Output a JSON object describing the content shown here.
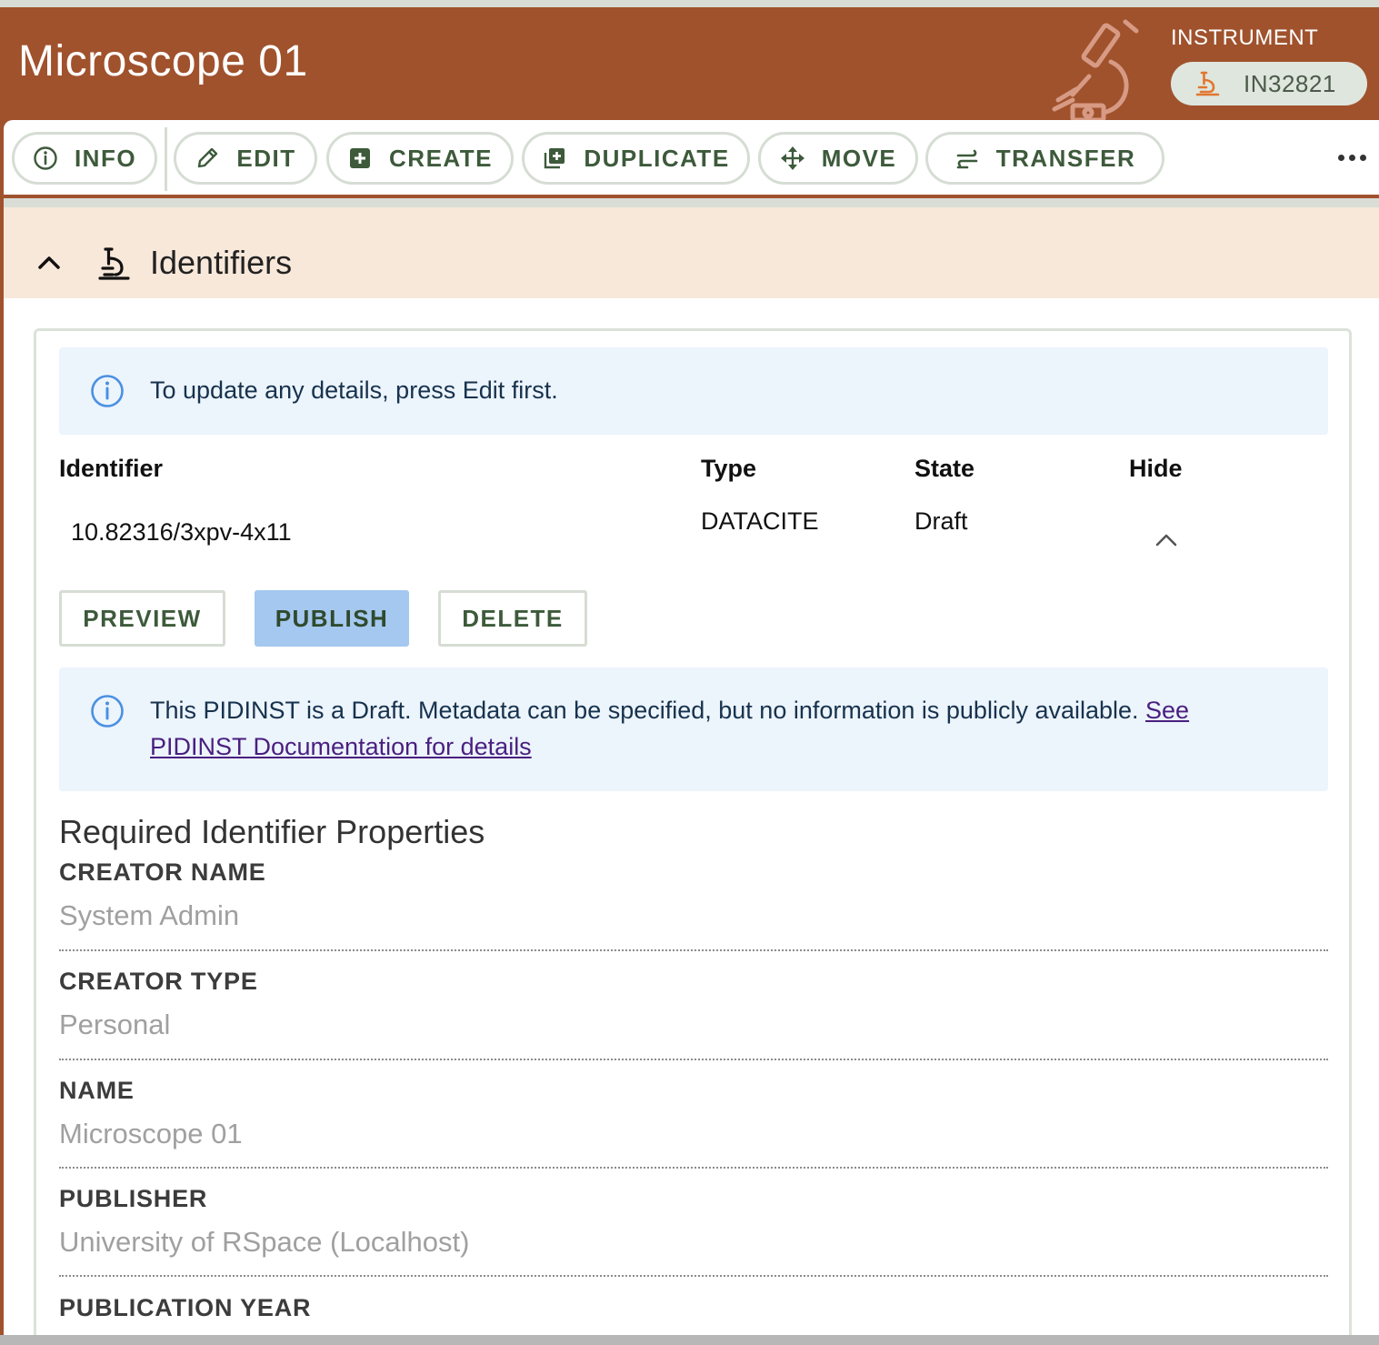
{
  "header": {
    "title": "Microscope 01",
    "type_label": "INSTRUMENT",
    "global_id": "IN32821",
    "background_icon": "microscope-icon"
  },
  "toolbar": {
    "buttons": [
      {
        "label": "INFO",
        "icon": "info-icon"
      },
      {
        "label": "EDIT",
        "icon": "pencil-icon"
      },
      {
        "label": "CREATE",
        "icon": "plus-box-icon"
      },
      {
        "label": "DUPLICATE",
        "icon": "duplicate-icon"
      },
      {
        "label": "MOVE",
        "icon": "move-arrows-icon"
      },
      {
        "label": "TRANSFER",
        "icon": "transfer-icon"
      }
    ],
    "more_icon": "more-horizontal-icon"
  },
  "section": {
    "title": "Identifiers",
    "expanded": true
  },
  "info_alert": {
    "text": "To update any details, press Edit first."
  },
  "identifier_table": {
    "headers": [
      "Identifier",
      "Type",
      "State",
      "Hide"
    ],
    "rows": [
      {
        "identifier": "10.82316/3xpv-4x11",
        "type": "DATACITE",
        "state": "Draft"
      }
    ]
  },
  "actions": {
    "preview": "PREVIEW",
    "publish": "PUBLISH",
    "delete": "DELETE"
  },
  "draft_alert": {
    "text": "This PIDINST is a Draft. Metadata can be specified, but no information is publicly available. ",
    "link_text": "See PIDINST Documentation for details"
  },
  "required_properties": {
    "heading": "Required Identifier Properties",
    "fields": [
      {
        "label": "CREATOR NAME",
        "value": "System Admin"
      },
      {
        "label": "CREATOR TYPE",
        "value": "Personal"
      },
      {
        "label": "NAME",
        "value": "Microscope 01"
      },
      {
        "label": "PUBLISHER",
        "value": "University of RSpace (Localhost)"
      },
      {
        "label": "PUBLICATION YEAR",
        "value": ""
      }
    ]
  },
  "colors": {
    "header_bg": "#a0522d",
    "section_header_bg": "#f8e8da",
    "alert_bg": "#ecf4fc",
    "button_text": "#3d5a3b",
    "publish_bg": "#a4c8ef",
    "icon_orange": "#e2762f"
  }
}
